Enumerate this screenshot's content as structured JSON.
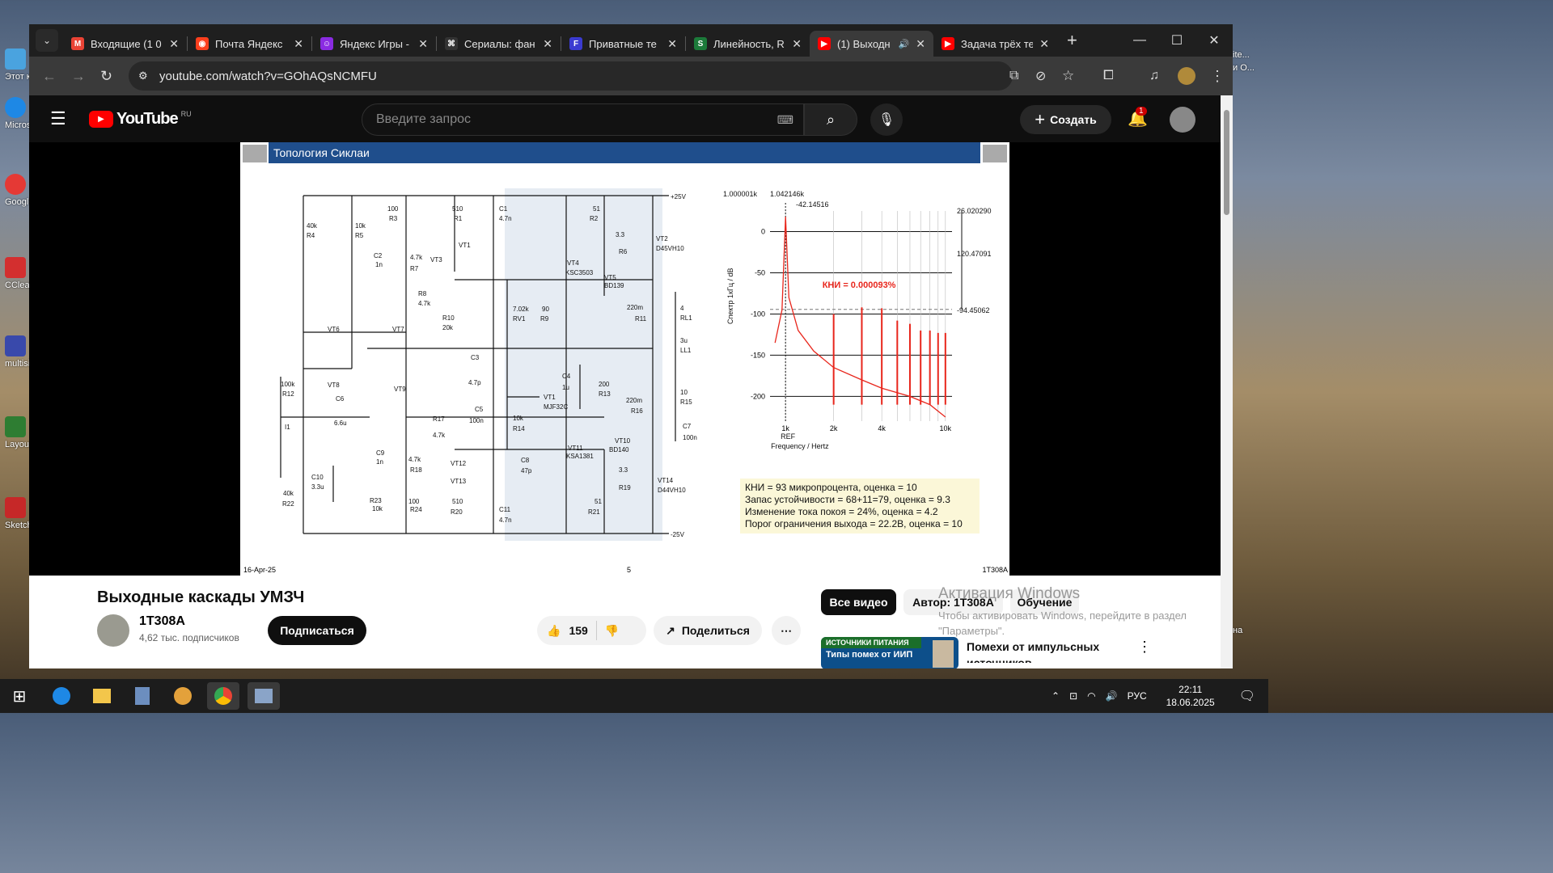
{
  "desktop": {
    "icons": [
      {
        "label": "Этот компьютер",
        "color": "#4aa3df"
      },
      {
        "label": "Microsoft Edge",
        "color": "#1e88e5"
      },
      {
        "label": "Google Chrome",
        "color": "#e53935"
      },
      {
        "label": "CCleaner",
        "color": "#d32f2f"
      },
      {
        "label": "multisim",
        "color": "#3949ab"
      },
      {
        "label": "Layout",
        "color": "#2e7d32"
      },
      {
        "label": "Sketch Layout",
        "color": "#c62828"
      }
    ],
    "right_labels": [
      "ite...",
      "и О...",
      "на"
    ]
  },
  "browser": {
    "tabs": [
      {
        "title": "Входящие (1 0",
        "icon": "gmail-icon",
        "color": "#ea4335",
        "glyph": "M"
      },
      {
        "title": "Почта Яндекс",
        "icon": "yandex-mail-icon",
        "color": "#fc3f1d",
        "glyph": "◉"
      },
      {
        "title": "Яндекс Игры -",
        "icon": "yandex-games-icon",
        "color": "#8a2be2",
        "glyph": "☺"
      },
      {
        "title": "Сериалы: фан",
        "icon": "series-icon",
        "color": "#333333",
        "glyph": "⌘"
      },
      {
        "title": "Приватные те",
        "icon": "f-icon",
        "color": "#3b3bd1",
        "glyph": "F"
      },
      {
        "title": "Линейность, R",
        "icon": "s-icon",
        "color": "#1c7a3a",
        "glyph": "S"
      },
      {
        "title": "(1) Выходн",
        "icon": "youtube-icon",
        "color": "#ff0000",
        "glyph": "▶",
        "active": true
      },
      {
        "title": "Задача трёх те",
        "icon": "youtube-icon",
        "color": "#ff0000",
        "glyph": "▶"
      }
    ],
    "url": "youtube.com/watch?v=GOhAQsNCMFU"
  },
  "youtube": {
    "logo_text": "YouTube",
    "region": "RU",
    "search_placeholder": "Введите запрос",
    "create_label": "Создать",
    "notif_count": "1",
    "video_title": "Выходные каскады УМЗЧ",
    "channel_name": "1T308A",
    "subscribers": "4,62 тыс. подписчиков",
    "subscribe_label": "Подписаться",
    "likes": "159",
    "share_label": "Поделиться",
    "filters": [
      "Все видео",
      "Автор: 1T308A",
      "Обучение"
    ],
    "rec_thumb_tag": "ИСТОЧНИКИ ПИТАНИЯ",
    "rec_thumb_title": "Типы помех от ИИП",
    "rec_title": "Помехи от импульсных источников",
    "activation_title": "Активация Windows",
    "activation_text": "Чтобы активировать Windows, перейдите в раздел \"Параметры\"."
  },
  "slide": {
    "title": "Топология Сиклаи",
    "date": "16-Apr-25",
    "page": "5",
    "author": "1T308A",
    "components": [
      "+25V",
      "-25V",
      "40k",
      "R4",
      "10k",
      "R5",
      "100",
      "R3",
      "510",
      "R1",
      "C1",
      "4.7n",
      "C2",
      "1n",
      "4.7k",
      "R7",
      "VT1",
      "VT3",
      "R8",
      "4.7k",
      "VT6",
      "VT7",
      "R10",
      "20k",
      "C3",
      "4.7p",
      "VT8",
      "VT9",
      "100k",
      "R12",
      "C6",
      "6.6u",
      "I1",
      "C5",
      "100n",
      "R17",
      "4.7k",
      "C9",
      "1n",
      "4.7k",
      "R18",
      "VT12",
      "VT13",
      "C10",
      "3.3u",
      "40k",
      "R22",
      "R23",
      "10k",
      "100",
      "R24",
      "510",
      "R20",
      "C11",
      "4.7n",
      "51",
      "R2",
      "3.3",
      "R6",
      "VT2",
      "D45VH10",
      "VT4",
      "KSC3503",
      "VT5",
      "BD139",
      "7.02k",
      "RV1",
      "90",
      "R9",
      "220m",
      "R11",
      "4",
      "RL1",
      "3u",
      "LL1",
      "C4",
      "1u",
      "200",
      "R13",
      "VT1",
      "MJF32C",
      "10",
      "R15",
      "220m",
      "R16",
      "C7",
      "100n",
      "10k",
      "R14",
      "VT11",
      "KSA1381",
      "VT10",
      "BD140",
      "C8",
      "47p",
      "3.3",
      "R19",
      "VT14",
      "D44VH10",
      "51",
      "R21"
    ],
    "info_lines": [
      "КНИ = 93 микропроцента, оценка = 10",
      "Запас устойчивости = 68+11=79, оценка = 9.3",
      "Изменение тока покоя = 24%, оценка = 4.2",
      "Порог ограничения выхода = 22.2В, оценка = 10"
    ]
  },
  "chart_data": {
    "type": "line",
    "ylabel": "Спектр 1кГц / dB",
    "xlabel": "Frequency / Hertz",
    "x_ticks": [
      "1k",
      "2k",
      "4k",
      "10k"
    ],
    "y_ticks": [
      0,
      -50,
      -100,
      -150,
      -200
    ],
    "ylim": [
      -230,
      25
    ],
    "marker_labels": [
      "1.000001k",
      "1.042146k",
      "-42.14516",
      "26.020290",
      "120.47091",
      "-94.45062",
      "REF"
    ],
    "annotation": "КНИ = 0.000093%",
    "noise_floor": [
      [
        860,
        -135
      ],
      [
        950,
        -95
      ],
      [
        1000,
        18
      ],
      [
        1050,
        -80
      ],
      [
        1200,
        -120
      ],
      [
        1500,
        -145
      ],
      [
        2000,
        -165
      ],
      [
        3000,
        -180
      ],
      [
        4000,
        -190
      ],
      [
        6000,
        -200
      ],
      [
        8000,
        -210
      ],
      [
        10000,
        -225
      ]
    ],
    "harmonics": [
      {
        "x": 2000,
        "y": -100
      },
      {
        "x": 3000,
        "y": -92
      },
      {
        "x": 4000,
        "y": -93
      },
      {
        "x": 5000,
        "y": -108
      },
      {
        "x": 6000,
        "y": -112
      },
      {
        "x": 7000,
        "y": -120
      },
      {
        "x": 8000,
        "y": -120
      },
      {
        "x": 9000,
        "y": -123
      },
      {
        "x": 10000,
        "y": -123
      }
    ]
  },
  "taskbar": {
    "lang": "РУС",
    "time": "22:11",
    "date": "18.06.2025"
  }
}
